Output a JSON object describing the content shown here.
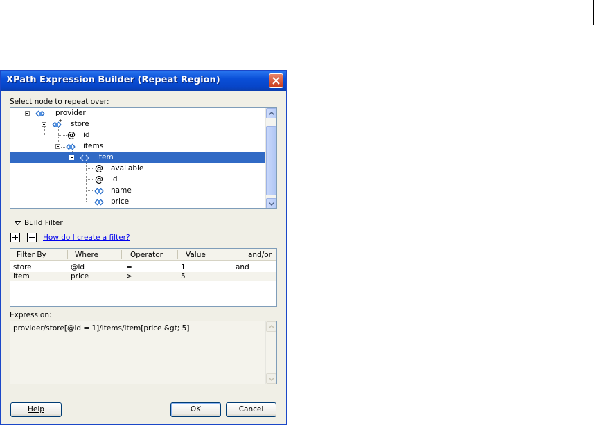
{
  "dialog": {
    "title": "XPath Expression Builder (Repeat Region)",
    "select_label": "Select node to repeat over:",
    "tree": [
      {
        "label": "provider",
        "icon": "element-icon",
        "expanded": true
      },
      {
        "label": "store",
        "icon": "repeating-element-icon",
        "expanded": true
      },
      {
        "label": "id",
        "icon": "attribute-icon"
      },
      {
        "label": "items",
        "icon": "element-icon",
        "expanded": true
      },
      {
        "label": "item",
        "icon": "element-icon",
        "expanded": true,
        "selected": true
      },
      {
        "label": "available",
        "icon": "attribute-icon"
      },
      {
        "label": "id",
        "icon": "attribute-icon"
      },
      {
        "label": "name",
        "icon": "element-icon"
      },
      {
        "label": "price",
        "icon": "element-icon"
      }
    ],
    "build_filter_label": "Build Filter",
    "help_link": "How do I create a filter?",
    "filter_columns": [
      "Filter By",
      "Where",
      "Operator",
      "Value",
      "and/or"
    ],
    "filter_rows": [
      [
        "store",
        "@id",
        "=",
        "1",
        "and"
      ],
      [
        "item",
        "price",
        ">",
        "5",
        ""
      ]
    ],
    "expression_label": "Expression:",
    "expression_value": "provider/store[@id = 1]/items/item[price &gt; 5]",
    "buttons": {
      "help": "Help",
      "ok": "OK",
      "cancel": "Cancel"
    },
    "colors": {
      "selection": "#316ac5",
      "titlebar": "#0a4fd8",
      "link": "#0000ee"
    }
  }
}
